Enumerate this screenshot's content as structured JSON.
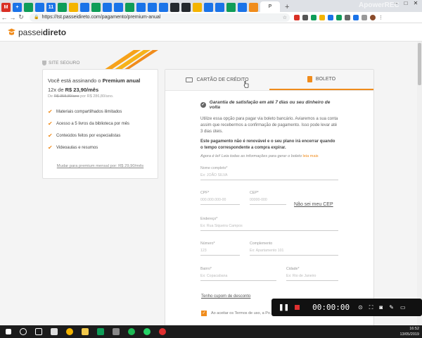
{
  "browser": {
    "tabs": [
      {
        "label": "M",
        "color": "#d93025"
      },
      {
        "label": "+",
        "color": "#1a73e8"
      },
      {
        "label": "",
        "color": "#0f9d58"
      },
      {
        "label": "",
        "color": "#1a73e8"
      },
      {
        "label": "11",
        "color": "#1a73e8"
      },
      {
        "label": "",
        "color": "#0f9d58"
      },
      {
        "label": "",
        "color": "#f4b400"
      },
      {
        "label": "",
        "color": "#1a73e8"
      },
      {
        "label": "",
        "color": "#0f9d58"
      },
      {
        "label": "",
        "color": "#1a73e8"
      },
      {
        "label": "",
        "color": "#1a73e8"
      },
      {
        "label": "",
        "color": "#0f9d58"
      },
      {
        "label": "",
        "color": "#1a73e8"
      },
      {
        "label": "",
        "color": "#1a73e8"
      },
      {
        "label": "",
        "color": "#1a73e8"
      },
      {
        "label": "",
        "color": "#24292e"
      },
      {
        "label": "",
        "color": "#24292e"
      },
      {
        "label": "",
        "color": "#f4b400"
      },
      {
        "label": "",
        "color": "#1a73e8"
      },
      {
        "label": "",
        "color": "#1a73e8"
      },
      {
        "label": "",
        "color": "#0f9d58"
      },
      {
        "label": "",
        "color": "#1a73e8"
      },
      {
        "label": "",
        "color": "#f08c1c"
      }
    ],
    "active_tab_label": "P",
    "url": "https://tst.passeidireto.com/pagamento/premium-anual",
    "window_controls": {
      "minimize": "–",
      "maximize": "□",
      "close": "✕"
    }
  },
  "site": {
    "logo_prefix": "passei",
    "logo_bold": "direto"
  },
  "secure_label": "SITE SEGURO",
  "plan": {
    "title_prefix": "Você está assinando o ",
    "title_bold": "Premium anual",
    "price_prefix": "12x de ",
    "price_bold": "R$ 23,90/mês",
    "old_prefix": "De ",
    "old_strike": "R$ 358,80/ano",
    "old_suffix": " por R$ 286,80/ano.",
    "features": [
      "Materiais compartilhados ilimitados",
      "Acesso a 5 livros da biblioteca por mês",
      "Conteúdos feitos por especialistas",
      "Videoaulas e resumos"
    ],
    "switch_link": "Mudar para premium mensal por: R$ 29,90/mês"
  },
  "payment": {
    "tab_card": "CARTÃO DE CRÉDITO",
    "tab_boleto": "BOLETO",
    "guarantee": "Garantia de satisfação em até 7 dias ou seu dinheiro de volta",
    "paragraph1": "Utilize essa opção para pagar via boleto bancário. Aviaremos a sua conta assim que recebermos a confirmação de pagamento. Isso pode levar até 3 dias úteis.",
    "paragraph2": "Este pagamento não é renovável e o seu plano irá encerrar quando o tempo correspondente a compra expirar.",
    "note_prefix": "Agora é lei! Leia todas as informações para gerar o boleto ",
    "note_link": "leia mais",
    "fields": {
      "name_label": "Nome completo*",
      "name_placeholder": "Ex: JOÃO SILVA",
      "cpf_label": "CPF*",
      "cpf_placeholder": "000.000.000-00",
      "cep_label": "CEP*",
      "cep_placeholder": "00000-000",
      "address_label": "Endereço*",
      "address_placeholder": "Ex: Rua Siqueira Campos",
      "number_label": "Número*",
      "number_placeholder": "123",
      "complement_label": "Complemento",
      "complement_placeholder": "Ex: Apartamento 101",
      "district_label": "Bairro*",
      "district_placeholder": "Ex: Copacabana",
      "city_label": "Cidade*",
      "city_placeholder": "Ex: Rio de Janeiro"
    },
    "cep_link": "Não sei meu CEP",
    "coupon_link": "Tenho cupom de desconto",
    "terms": "Ao aceitar os Termos de uso, a Po... serviços."
  },
  "recorder": {
    "time": "00:00:00",
    "watermark": "ApowerREC"
  },
  "taskbar": {
    "time": "16:52",
    "date": "13/05/2019"
  }
}
